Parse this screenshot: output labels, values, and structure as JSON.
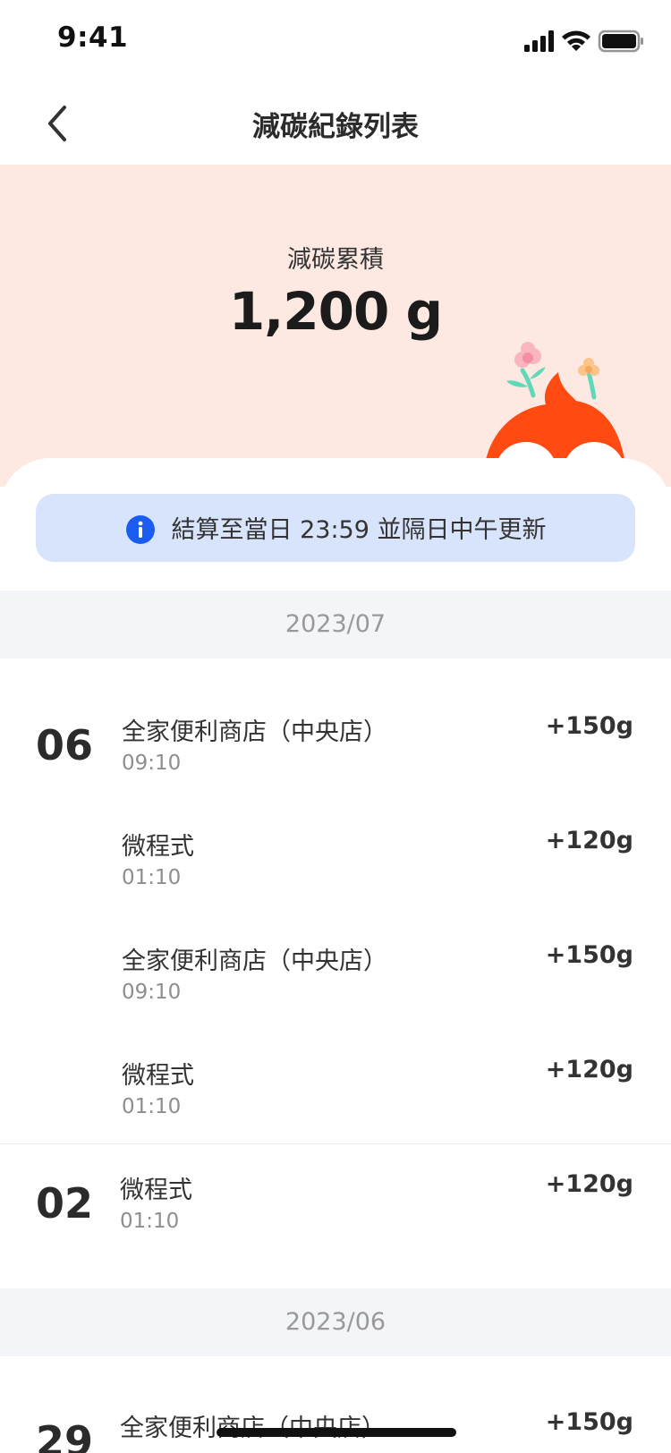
{
  "status_bar": {
    "time": "9:41"
  },
  "nav": {
    "title": "減碳紀錄列表"
  },
  "summary": {
    "label": "減碳累積",
    "value": "1,200 g"
  },
  "notice": {
    "text": "結算至當日 23:59 並隔日中午更新"
  },
  "months": [
    {
      "label": "2023/07",
      "days": [
        {
          "day": "06",
          "entries": [
            {
              "title": "全家便利商店（中央店）",
              "time": "09:10",
              "amount": "+150g"
            },
            {
              "title": "微程式",
              "time": "01:10",
              "amount": "+120g"
            },
            {
              "title": "全家便利商店（中央店）",
              "time": "09:10",
              "amount": "+150g"
            },
            {
              "title": "微程式",
              "time": "01:10",
              "amount": "+120g"
            }
          ]
        },
        {
          "day": "02",
          "entries": [
            {
              "title": "微程式",
              "time": "01:10",
              "amount": "+120g"
            }
          ]
        }
      ]
    },
    {
      "label": "2023/06",
      "days": [
        {
          "day": "29",
          "entries": [
            {
              "title": "全家便利商店（中央店）",
              "time": "",
              "amount": "+150g"
            }
          ]
        }
      ]
    }
  ],
  "colors": {
    "hero_bg": "#fde9e2",
    "notice_bg": "#d8e4fb",
    "info_icon": "#1a5cf0",
    "mascot_orange": "#ff4a12",
    "month_bar_bg": "#f4f5f8"
  },
  "icons": {
    "back": "chevron-left-icon",
    "info": "info-icon",
    "signal": "signal-icon",
    "wifi": "wifi-icon",
    "battery": "battery-icon"
  }
}
